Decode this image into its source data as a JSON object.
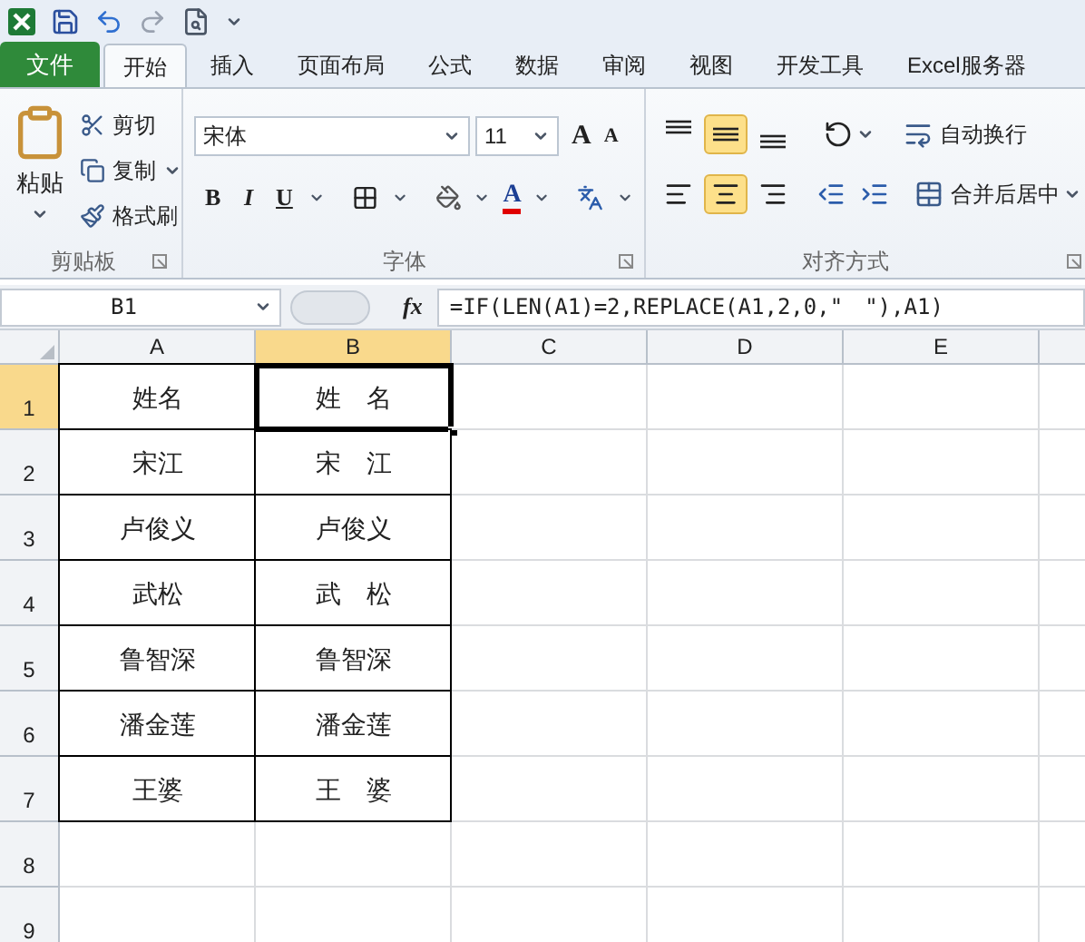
{
  "tabs": [
    {
      "label": "文件",
      "kind": "file",
      "selected": false
    },
    {
      "label": "开始",
      "kind": "tab",
      "selected": true
    },
    {
      "label": "插入",
      "kind": "tab",
      "selected": false
    },
    {
      "label": "页面布局",
      "kind": "tab",
      "selected": false
    },
    {
      "label": "公式",
      "kind": "tab",
      "selected": false
    },
    {
      "label": "数据",
      "kind": "tab",
      "selected": false
    },
    {
      "label": "审阅",
      "kind": "tab",
      "selected": false
    },
    {
      "label": "视图",
      "kind": "tab",
      "selected": false
    },
    {
      "label": "开发工具",
      "kind": "tab",
      "selected": false
    },
    {
      "label": "Excel服务器",
      "kind": "tab",
      "selected": false
    }
  ],
  "clipboard": {
    "paste": "粘贴",
    "items": [
      "剪切",
      "复制",
      "格式刷"
    ],
    "label": "剪贴板"
  },
  "font": {
    "font_name": "宋体",
    "font_size": "11",
    "grow": "A",
    "shrink": "A",
    "bold": "B",
    "italic": "I",
    "underline": "U",
    "font_color": "A",
    "label": "字体"
  },
  "alignment": {
    "vertical": [
      {
        "selected": false
      },
      {
        "selected": true
      },
      {
        "selected": false
      }
    ],
    "horizontal": [
      {
        "selected": false
      },
      {
        "selected": true
      },
      {
        "selected": false
      }
    ],
    "wrap_text": "自动换行",
    "merge_center": "合并后居中",
    "label": "对齐方式"
  },
  "formula_bar": {
    "name_box": "B1",
    "fx": "fx",
    "formula": "=IF(LEN(A1)=2,REPLACE(A1,2,0,\"　\"),A1)"
  },
  "sheet": {
    "columns": [
      {
        "label": "A",
        "selected": false
      },
      {
        "label": "B",
        "selected": true
      },
      {
        "label": "C",
        "selected": false
      },
      {
        "label": "D",
        "selected": false
      },
      {
        "label": "E",
        "selected": false
      }
    ],
    "rows": [
      {
        "label": "1",
        "selected": true,
        "cells": [
          {
            "text": "姓名",
            "selected": false
          },
          {
            "text": "姓　名",
            "selected": true
          }
        ]
      },
      {
        "label": "2",
        "selected": false,
        "cells": [
          {
            "text": "宋江",
            "selected": false
          },
          {
            "text": "宋　江",
            "selected": false
          }
        ]
      },
      {
        "label": "3",
        "selected": false,
        "cells": [
          {
            "text": "卢俊义",
            "selected": false
          },
          {
            "text": "卢俊义",
            "selected": false
          }
        ]
      },
      {
        "label": "4",
        "selected": false,
        "cells": [
          {
            "text": "武松",
            "selected": false
          },
          {
            "text": "武　松",
            "selected": false
          }
        ]
      },
      {
        "label": "5",
        "selected": false,
        "cells": [
          {
            "text": "鲁智深",
            "selected": false
          },
          {
            "text": "鲁智深",
            "selected": false
          }
        ]
      },
      {
        "label": "6",
        "selected": false,
        "cells": [
          {
            "text": "潘金莲",
            "selected": false
          },
          {
            "text": "潘金莲",
            "selected": false
          }
        ]
      },
      {
        "label": "7",
        "selected": false,
        "cells": [
          {
            "text": "王婆",
            "selected": false
          },
          {
            "text": "王　婆",
            "selected": false
          }
        ]
      },
      {
        "label": "8",
        "selected": false,
        "cells": []
      },
      {
        "label": "9",
        "selected": false,
        "cells": []
      }
    ]
  }
}
